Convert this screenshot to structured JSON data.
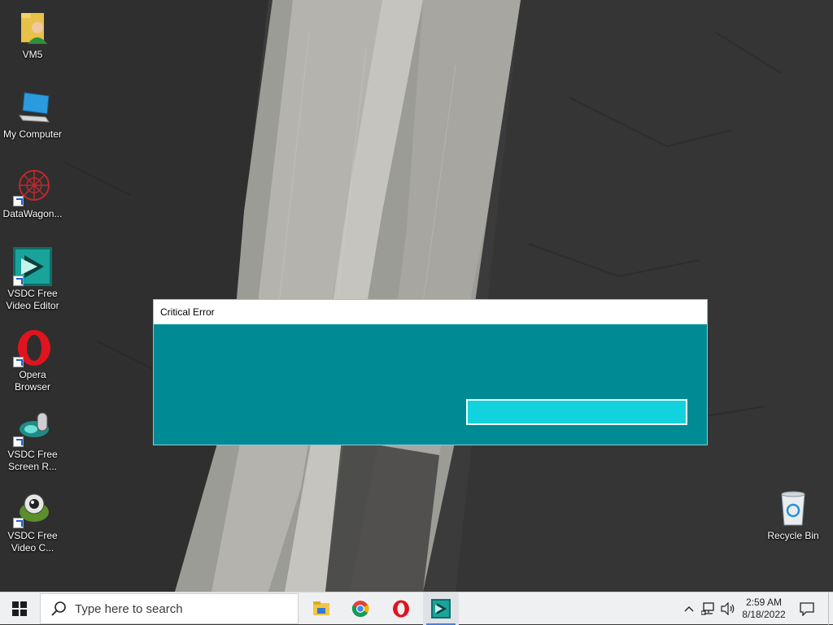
{
  "desktop": {
    "icons": [
      {
        "label": "VM5",
        "icon": "folder-user-icon"
      },
      {
        "label": "My Computer",
        "icon": "computer-icon"
      },
      {
        "label": "DataWagon...",
        "icon": "datawagon-icon",
        "shortcut": true
      },
      {
        "label": "VSDC Free Video Editor",
        "icon": "vsdc-editor-icon",
        "shortcut": true
      },
      {
        "label": "Opera Browser",
        "icon": "opera-icon",
        "shortcut": true
      },
      {
        "label": "VSDC Free Screen R...",
        "icon": "vsdc-screen-recorder-icon",
        "shortcut": true
      },
      {
        "label": "VSDC Free Video C...",
        "icon": "vsdc-video-capture-icon",
        "shortcut": true
      },
      {
        "label": "Recycle Bin",
        "icon": "recycle-bin-icon"
      }
    ]
  },
  "dialog": {
    "title": "Critical Error",
    "body_color": "#008b94",
    "button_color": "#12d3dd",
    "button_label": ""
  },
  "taskbar": {
    "search_placeholder": "Type here to search",
    "pinned": [
      "file-explorer-icon",
      "chrome-icon",
      "opera-icon",
      "vsdc-editor-icon"
    ],
    "active": "vsdc-editor-icon",
    "clock": {
      "time": "2:59 AM",
      "date": "8/18/2022"
    },
    "tray": [
      "chevron-up-icon",
      "network-icon",
      "volume-icon",
      "notification-icon"
    ]
  }
}
